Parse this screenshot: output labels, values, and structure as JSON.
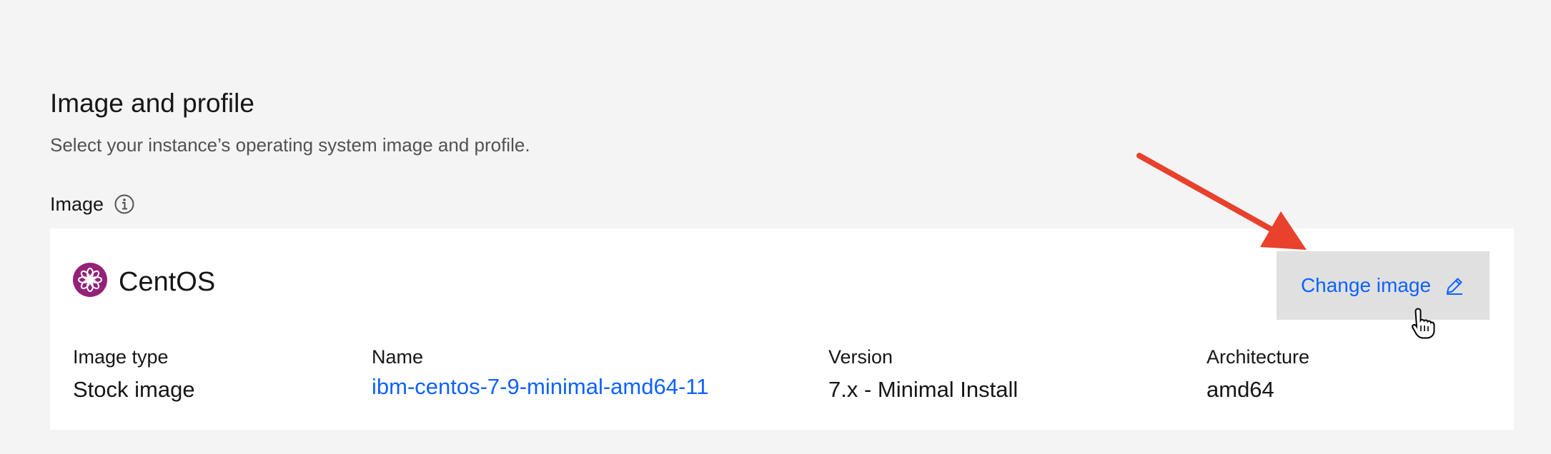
{
  "section": {
    "title": "Image and profile",
    "description": "Select your instance’s operating system image and profile."
  },
  "image_field": {
    "label": "Image",
    "info_icon": "info-icon"
  },
  "image_card": {
    "os_name": "CentOS",
    "os_logo": "centos-logo-icon",
    "change_button_label": "Change image",
    "change_button_icon": "edit-icon",
    "details": [
      {
        "label": "Image type",
        "value": "Stock image"
      },
      {
        "label": "Name",
        "value": "ibm-centos-7-9-minimal-amd64-11"
      },
      {
        "label": "Version",
        "value": "7.x - Minimal Install"
      },
      {
        "label": "Architecture",
        "value": "amd64"
      }
    ]
  },
  "annotation": {
    "arrow_icon": "arrow-icon",
    "cursor_icon": "hand-pointer-icon",
    "arrow_color": "#e8412c"
  },
  "colors": {
    "page_background": "#f4f4f4",
    "card_background": "#ffffff",
    "link": "#0f62fe",
    "button_background": "#e0e0e0",
    "centos_purple": "#932279"
  }
}
